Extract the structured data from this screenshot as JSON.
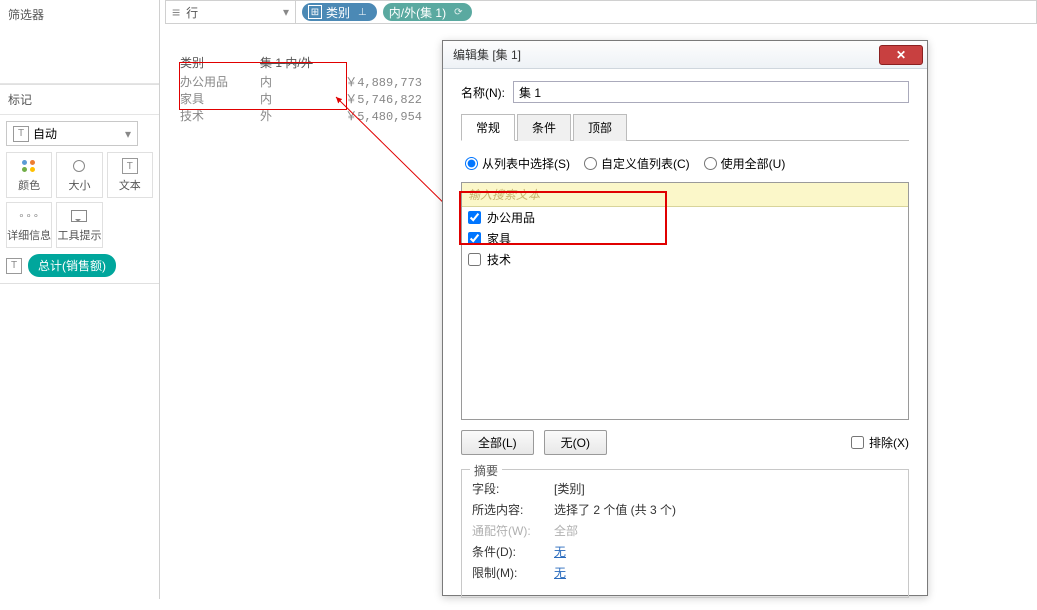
{
  "sidebar": {
    "filter_header": "筛选器",
    "marks_header": "标记",
    "marks_mode": "自动",
    "cells": {
      "color": "颜色",
      "size": "大小",
      "text": "文本",
      "detail": "详细信息",
      "tooltip": "工具提示"
    },
    "pill_total": "总计(销售额)"
  },
  "shelf": {
    "rows_label": "行",
    "pill_category": "类别",
    "pill_inout": "内/外(集 1)"
  },
  "crosstab": {
    "head_category": "类别",
    "head_set": "集 1",
    "head_inout": "内/外",
    "rows": [
      {
        "cat": "办公用品",
        "io": "内",
        "val": "￥4,889,773"
      },
      {
        "cat": "家具",
        "io": "内",
        "val": "￥5,746,822"
      },
      {
        "cat": "技术",
        "io": "外",
        "val": "￥5,480,954"
      }
    ]
  },
  "dialog": {
    "title": "编辑集 [集 1]",
    "name_label": "名称(N):",
    "name_value": "集 1",
    "tabs": {
      "general": "常规",
      "condition": "条件",
      "top": "顶部"
    },
    "radios": {
      "from_list": "从列表中选择(S)",
      "custom_list": "自定义值列表(C)",
      "use_all": "使用全部(U)"
    },
    "search_placeholder": "输入搜索文本",
    "items": [
      {
        "label": "办公用品",
        "checked": true
      },
      {
        "label": "家具",
        "checked": true
      },
      {
        "label": "技术",
        "checked": false
      }
    ],
    "btn_all": "全部(L)",
    "btn_none": "无(O)",
    "exclude_label": "排除(X)",
    "summary": {
      "title": "摘要",
      "field_k": "字段:",
      "field_v": "[类别]",
      "sel_k": "所选内容:",
      "sel_v": "选择了 2 个值 (共 3 个)",
      "wc_k": "通配符(W):",
      "wc_v": "全部",
      "cond_k": "条件(D):",
      "cond_v": "无",
      "lim_k": "限制(M):",
      "lim_v": "无"
    }
  }
}
